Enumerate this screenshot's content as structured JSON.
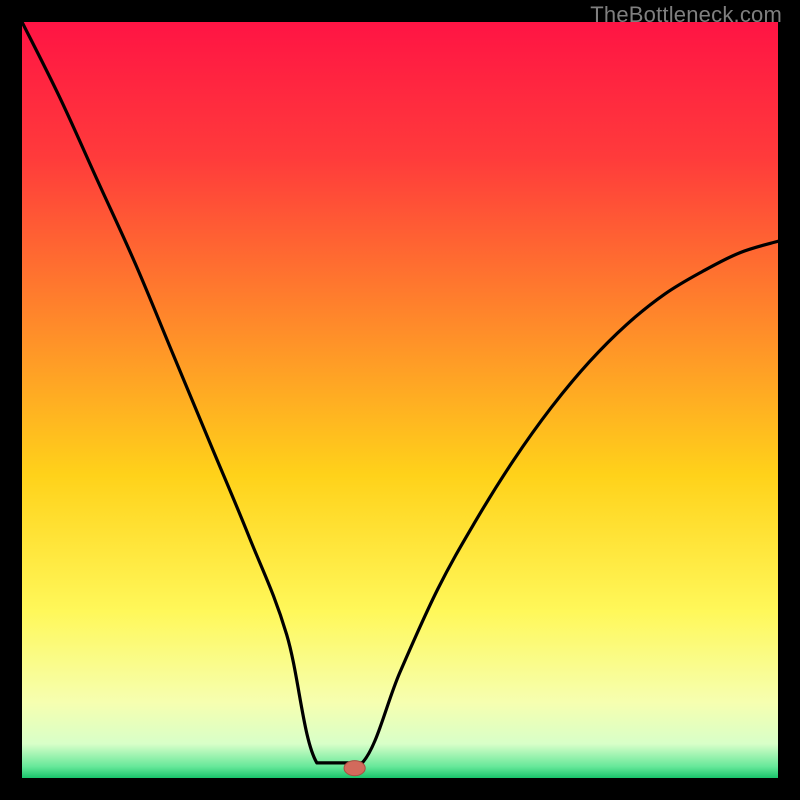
{
  "watermark": "TheBottleneck.com",
  "colors": {
    "frame": "#000000",
    "curve": "#000000",
    "marker_fill": "#d26a5c",
    "marker_stroke": "#a84f43",
    "gradient_stops": [
      {
        "offset": 0,
        "color": "#ff1444"
      },
      {
        "offset": 0.18,
        "color": "#ff3b3b"
      },
      {
        "offset": 0.4,
        "color": "#ff8a2a"
      },
      {
        "offset": 0.6,
        "color": "#ffd21a"
      },
      {
        "offset": 0.78,
        "color": "#fff85a"
      },
      {
        "offset": 0.9,
        "color": "#f6ffb0"
      },
      {
        "offset": 0.955,
        "color": "#d8ffc8"
      },
      {
        "offset": 0.985,
        "color": "#66e89a"
      },
      {
        "offset": 1.0,
        "color": "#19c36b"
      }
    ]
  },
  "chart_data": {
    "type": "line",
    "title": "",
    "xlabel": "",
    "ylabel": "",
    "xlim": [
      0,
      100
    ],
    "ylim": [
      0,
      100
    ],
    "notch": {
      "x_min": 39,
      "x_max": 45,
      "x_center": 42
    },
    "marker": {
      "x": 44,
      "y": 1.3,
      "rx": 1.4,
      "ry": 1.0
    },
    "series": [
      {
        "name": "bottleneck-curve",
        "x": [
          0,
          5,
          10,
          15,
          20,
          25,
          30,
          35,
          39,
          45,
          50,
          55,
          60,
          65,
          70,
          75,
          80,
          85,
          90,
          95,
          100
        ],
        "values": [
          100,
          90,
          79,
          68,
          56,
          44,
          32,
          19,
          2,
          2,
          14,
          25,
          34,
          42,
          49,
          55,
          60,
          64,
          67,
          69.5,
          71
        ]
      }
    ]
  }
}
